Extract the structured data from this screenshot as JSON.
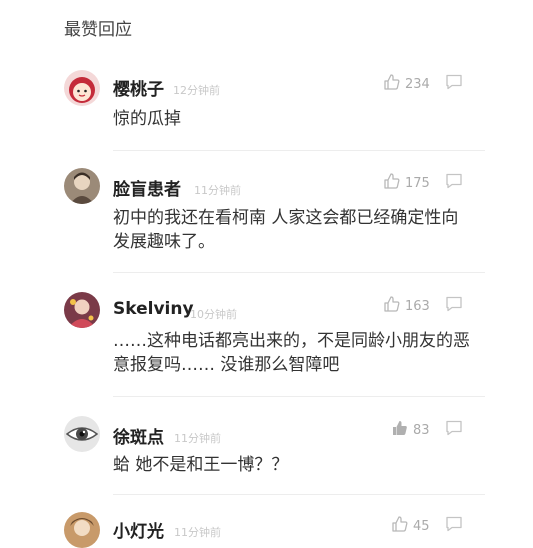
{
  "section_title": "最赞回应",
  "comments": [
    {
      "username": "樱桃子",
      "time": "12分钟前",
      "likes": "234",
      "content": "惊的瓜掉"
    },
    {
      "username": "脸盲患者",
      "time": "11分钟前",
      "likes": "175",
      "content": "初中的我还在看柯南 人家这会都已经确定性向发展趣味了。"
    },
    {
      "username": "Skelviny",
      "time": "10分钟前",
      "likes": "163",
      "content": "……这种电话都亮出来的，不是同龄小朋友的恶意报复吗…… 没谁那么智障吧"
    },
    {
      "username": "徐斑点",
      "time": "11分钟前",
      "likes": "83",
      "content": "蛤 她不是和王一博？？"
    },
    {
      "username": "小灯光",
      "time": "11分钟前",
      "likes": "45",
      "content": ""
    }
  ]
}
